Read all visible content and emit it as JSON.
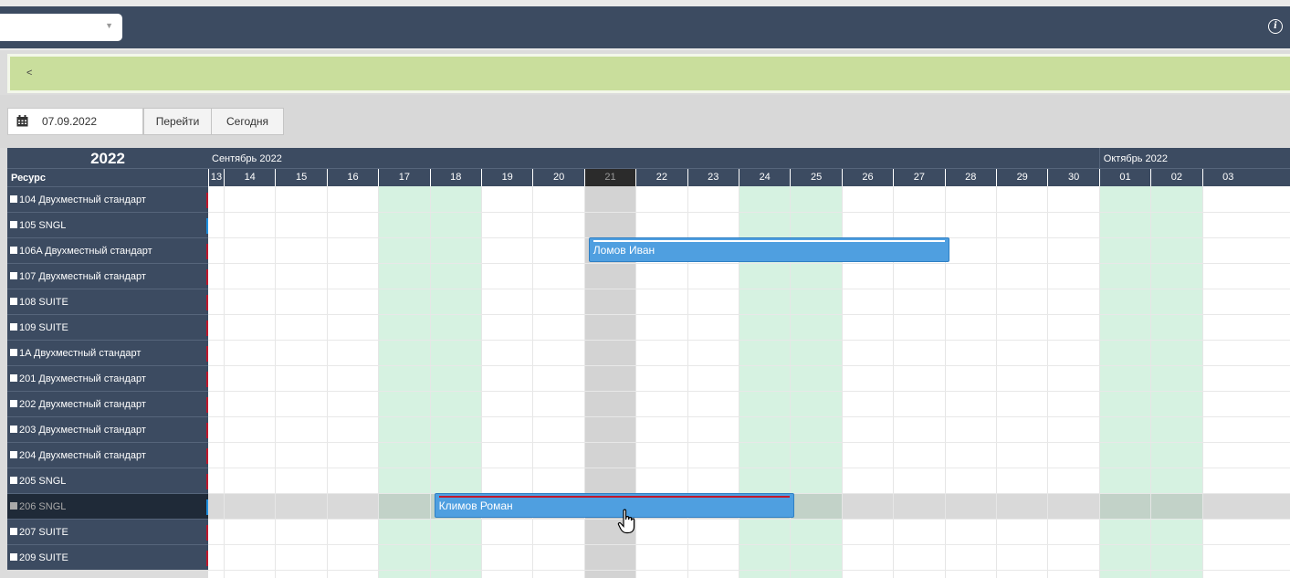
{
  "topbar": {
    "select_value": "",
    "select_caret": "▼",
    "info_glyph": "i"
  },
  "banner": {
    "arrow": "<"
  },
  "toolbar": {
    "date_value": "07.09.2022",
    "go_label": "Перейти",
    "today_label": "Сегодня"
  },
  "scheduler": {
    "year": "2022",
    "resource_header": "Ресурс",
    "months": [
      "Сентябрь 2022",
      "Октябрь 2022"
    ],
    "days": [
      "13",
      "14",
      "15",
      "16",
      "17",
      "18",
      "19",
      "20",
      "21",
      "22",
      "23",
      "24",
      "25",
      "26",
      "27",
      "28",
      "29",
      "30",
      "01",
      "02",
      "03"
    ],
    "today_index": 8,
    "weekend_indexes": [
      4,
      5,
      11,
      12,
      18,
      19
    ],
    "resources": [
      {
        "label": "104 Двухместный стандарт",
        "marker": "#c0182d"
      },
      {
        "label": "105 SNGL",
        "marker": "#1d8fe0"
      },
      {
        "label": "106A Двухместный стандарт",
        "marker": "#c0182d"
      },
      {
        "label": "107 Двухместный стандарт",
        "marker": "#c0182d"
      },
      {
        "label": "108 SUITE",
        "marker": "#c0182d"
      },
      {
        "label": "109 SUITE",
        "marker": "#c0182d"
      },
      {
        "label": "1A Двухместный стандарт",
        "marker": "#c0182d"
      },
      {
        "label": "201 Двухместный стандарт",
        "marker": "#c0182d"
      },
      {
        "label": "202 Двухместный стандарт",
        "marker": "#c0182d"
      },
      {
        "label": "203 Двухместный стандарт",
        "marker": "#c0182d"
      },
      {
        "label": "204 Двухместный стандарт",
        "marker": "#c0182d"
      },
      {
        "label": "205 SNGL",
        "marker": "#c0182d"
      },
      {
        "label": "206 SNGL",
        "marker": "#1d8fe0"
      },
      {
        "label": "207 SUITE",
        "marker": "#c0182d"
      },
      {
        "label": "209 SUITE",
        "marker": "#c0182d"
      }
    ],
    "selected_row": 12,
    "bookings": [
      {
        "guest": "Ломов Иван",
        "row": 2,
        "start_day": "21",
        "end_day": "28",
        "strip": "#ffffff"
      },
      {
        "guest": "Климов Роман",
        "row": 12,
        "start_day": "18",
        "end_day": "25",
        "strip": "#c0182d"
      }
    ]
  },
  "colors": {
    "header_bg": "#3c4b61",
    "banner_bg": "#c9de9c",
    "weekend_bg": "#d6f2e1",
    "today_bg": "#d3d3d3",
    "booking_bg": "#4f9fe0"
  }
}
